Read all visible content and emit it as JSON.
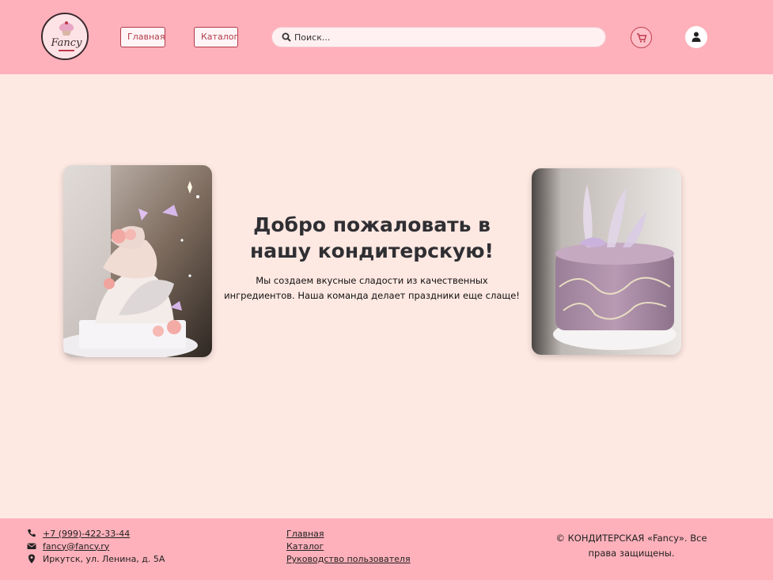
{
  "header": {
    "logo_text": "Fancy",
    "nav": {
      "home": "Главная",
      "catalog": "Каталог"
    },
    "search": {
      "placeholder": "Поиск..."
    }
  },
  "hero": {
    "title": "Добро пожаловать в нашу кондитерскую!",
    "text": "Мы создаем вкусные сладости из качественных ингредиентов. Наша команда делает праздники еще слаще!"
  },
  "footer": {
    "contacts": {
      "phone": "+7 (999)-422-33-44",
      "email": "fancy@fancy.ry",
      "address": "Иркутск, ул. Ленина, д. 5А"
    },
    "links": [
      "Главная",
      "Каталог",
      "Руководство пользователя"
    ],
    "copyright": "© КОНДИТЕРСКАЯ «Fancy». Все права защищены."
  },
  "colors": {
    "header_bg": "#feb1bb",
    "page_bg": "#fee8e2",
    "accent": "#b23b4a"
  }
}
